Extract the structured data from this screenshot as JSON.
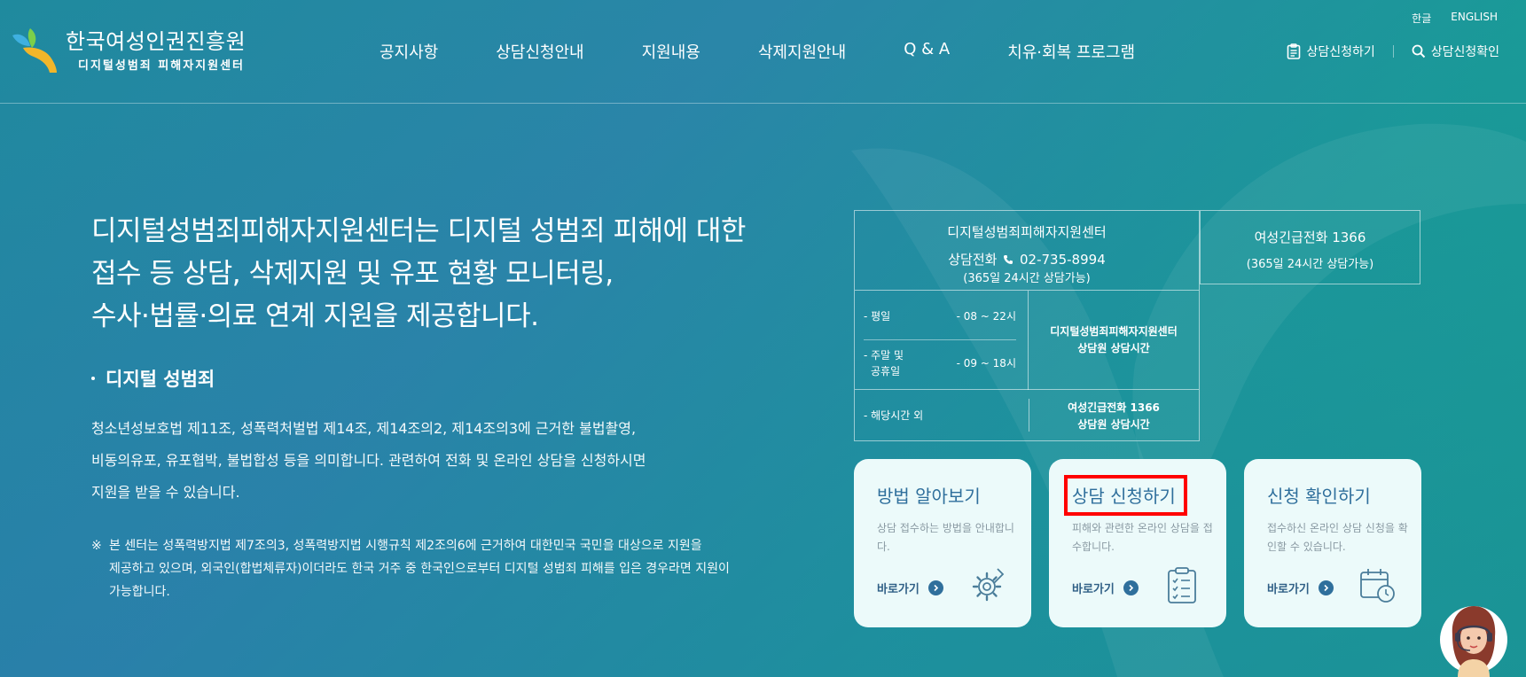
{
  "header": {
    "logo": {
      "title": "한국여성인권진흥원",
      "subtitle": "디지털성범죄 피해자지원센터"
    },
    "lang": [
      "한글",
      "ENGLISH"
    ],
    "nav": [
      "공지사항",
      "상담신청안내",
      "지원내용",
      "삭제지원안내",
      "Q & A",
      "치유·회복 프로그램"
    ],
    "util": {
      "apply": "상담신청하기",
      "check": "상담신청확인"
    }
  },
  "intro": {
    "lines": [
      "디지털성범죄피해자지원센터는 디지털 성범죄 피해에 대한",
      "접수 등 상담, 삭제지원 및 유포 현황 모니터링,",
      "수사·법률·의료 연계 지원을 제공합니다."
    ],
    "section_title": "디지털 성범죄",
    "desc": [
      "청소년성보호법 제11조, 성폭력처벌법 제14조, 제14조의2, 제14조의3에 근거한 불법촬영,",
      "비동의유포, 유포협박, 불법합성 등을 의미합니다. 관련하여 전화 및 온라인 상담을 신청하시면",
      "지원을 받을 수 있습니다."
    ],
    "note_mark": "※",
    "note": [
      "본 센터는 성폭력방지법 제7조의3, 성폭력방지법 시행규칙 제2조의6에 근거하여 대한민국 국민을 대상으로 지원을",
      "제공하고 있으며, 외국인(합법체류자)이더라도 한국 거주 중 한국인으로부터 디지털 성범죄 피해를 입은 경우라면 지원이",
      "가능합니다."
    ]
  },
  "info": {
    "center_name": "디지털성범죄피해자지원센터",
    "phone_label": "상담전화",
    "phone_number": "02-735-8994",
    "phone_hours": "(365일 24시간 상담가능)",
    "weekday_label": "- 평일",
    "weekday_time": "- 08 ~ 22시",
    "weekend_label_1": "- 주말 및",
    "weekend_label_2": "공휴일",
    "weekend_time": "- 09 ~ 18시",
    "center_staff_1": "디지털성범죄피해자지원센터",
    "center_staff_2": "상담원 상담시간",
    "off_label": "- 해당시간 외",
    "off_staff_1": "여성긴급전화 1366",
    "off_staff_2": "상담원 상담시간",
    "side_title": "여성긴급전화 1366",
    "side_hours": "(365일 24시간 상담가능)"
  },
  "cards": [
    {
      "title": "방법 알아보기",
      "desc": "상담 접수하는 방법을 안내합니다.",
      "go": "바로가기",
      "icon": "gear-icon"
    },
    {
      "title": "상담 신청하기",
      "desc": "피해와 관련한 온라인 상담을 접수합니다.",
      "go": "바로가기",
      "icon": "checklist-icon"
    },
    {
      "title": "신청 확인하기",
      "desc": "접수하신 온라인 상담 신청을 확인할 수 있습니다.",
      "go": "바로가기",
      "icon": "calendar-clock-icon"
    }
  ],
  "colors": {
    "accent": "#2f6f9c",
    "card_bg": "#ecfafa",
    "highlight": "#ff0000"
  }
}
